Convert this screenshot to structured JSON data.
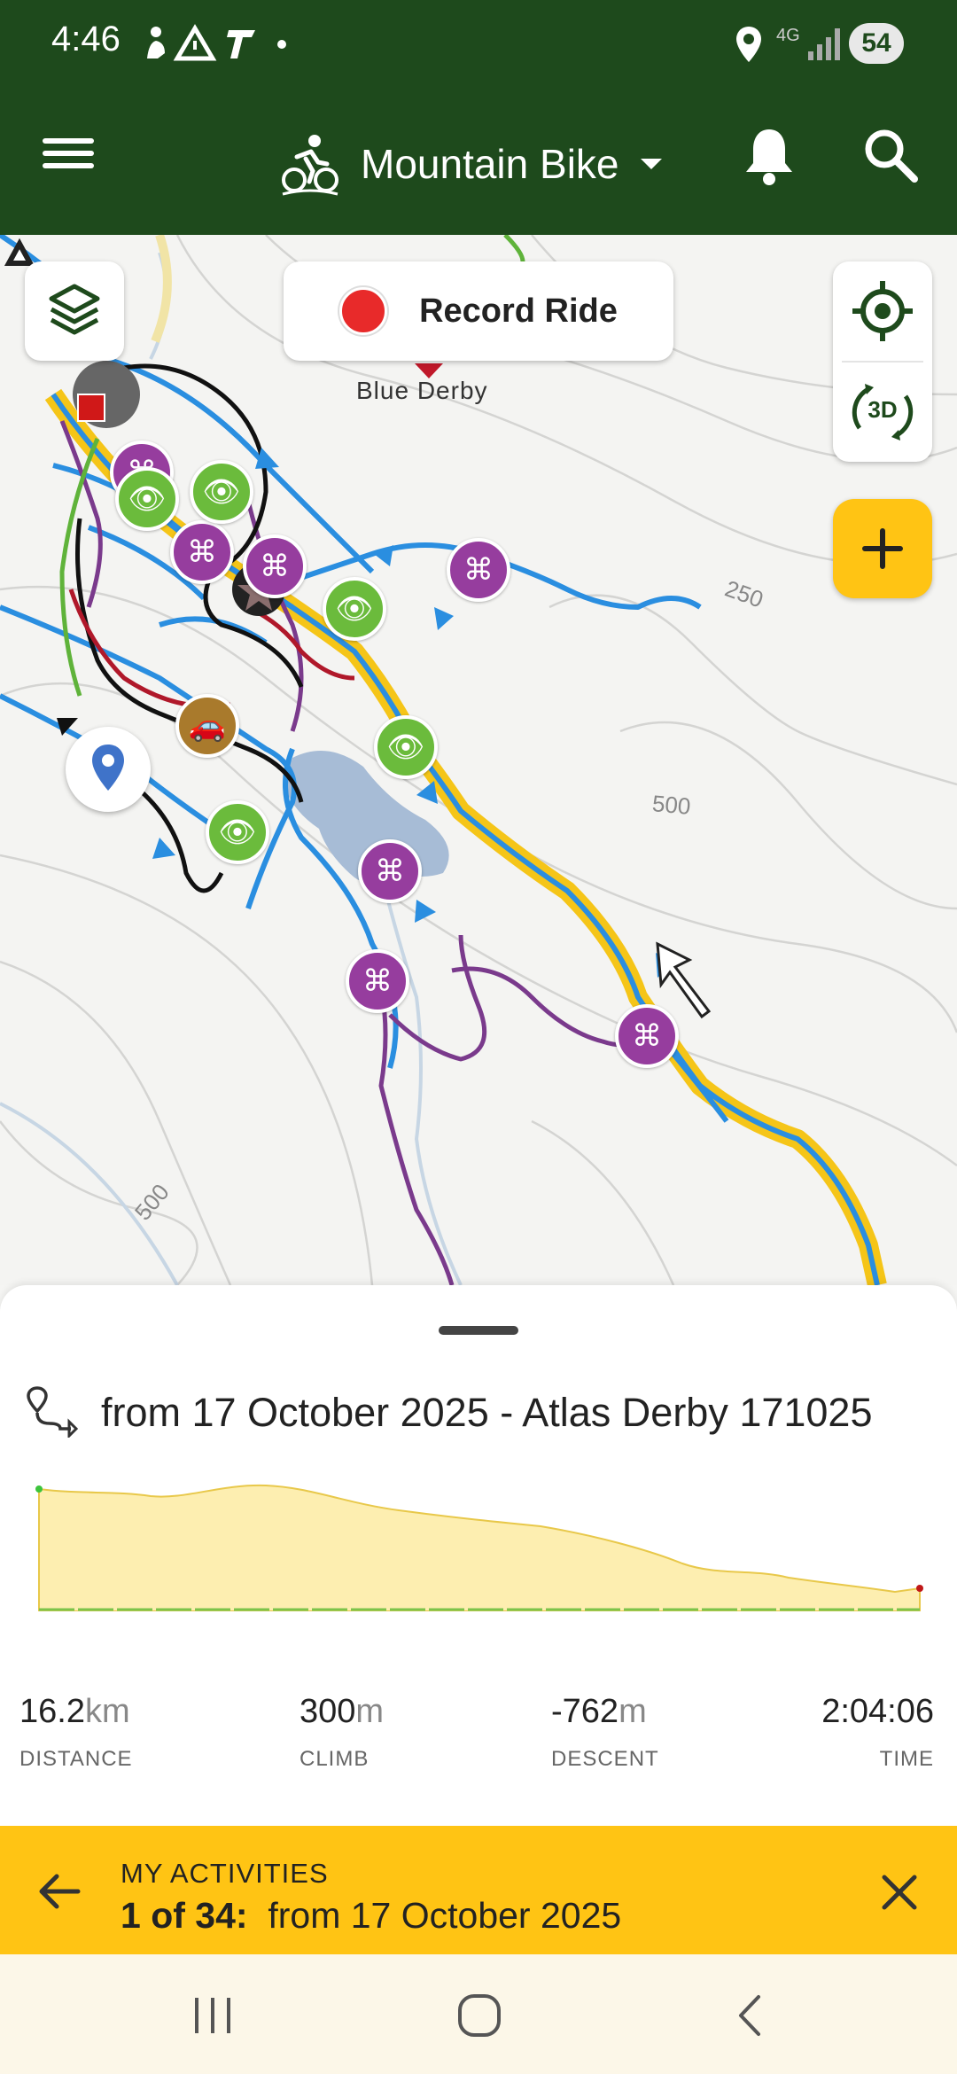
{
  "status_bar": {
    "time": "4:46",
    "network": "4G",
    "battery": "54"
  },
  "app_bar": {
    "activity": "Mountain Bike"
  },
  "map": {
    "record_label": "Record Ride",
    "view_3d_label": "3D",
    "place_label": "Blue Derby",
    "contours": [
      "250",
      "500",
      "500"
    ],
    "colors": {
      "trail_blue": "#2a8ee0",
      "trail_purple": "#7a3a8c",
      "trail_black": "#111111",
      "trail_red": "#b0182a",
      "track_yellow": "#f5c518",
      "water": "#a7bcd6"
    }
  },
  "route": {
    "title": "from 17 October 2025 - Atlas Derby 171025",
    "stats": [
      {
        "value": "16.2",
        "unit": "km",
        "label": "DISTANCE"
      },
      {
        "value": "300",
        "unit": "m",
        "label": "CLIMB"
      },
      {
        "value": "-762",
        "unit": "m",
        "label": "DESCENT"
      },
      {
        "value": "2:04:06",
        "unit": "",
        "label": "TIME"
      }
    ]
  },
  "banner": {
    "subtitle": "MY ACTIVITIES",
    "position": "1 of 34:",
    "name": "from 17 October 2025"
  },
  "colors": {
    "header_green": "#1e4a1c",
    "accent_yellow": "#ffc414"
  }
}
